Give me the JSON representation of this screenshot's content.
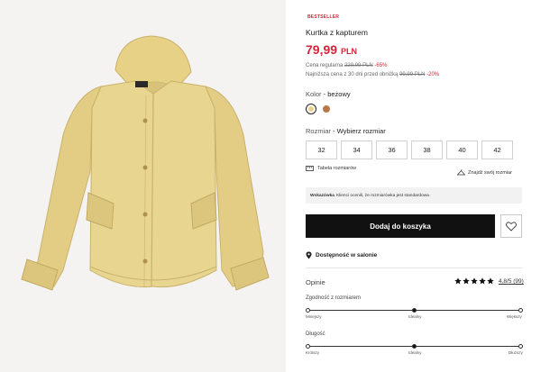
{
  "product": {
    "badge": "BESTSELLER",
    "title": "Kurtka z kapturem",
    "price": "79,99",
    "currency": "PLN",
    "regular_label": "Cena regularna",
    "regular_price": "229,99 PLN",
    "regular_discount": "-65%",
    "lowest_label": "Najniższa cena z 30 dni przed obniżką",
    "lowest_price": "99,99 PLN",
    "lowest_discount": "-20%"
  },
  "color": {
    "label": "Kolor",
    "value": "- beżowy",
    "swatches": [
      {
        "name": "beżowy",
        "hex": "#e8d28a",
        "selected": true
      },
      {
        "name": "brązowy",
        "hex": "#b8794a",
        "selected": false
      }
    ]
  },
  "size": {
    "label": "Rozmiar",
    "value": "- Wybierz rozmiar",
    "options": [
      "32",
      "34",
      "36",
      "38",
      "40",
      "42"
    ],
    "table_link": "Tabela rozmiarów",
    "find_link": "Znajdź swój rozmiar"
  },
  "hint": {
    "bold": "Wskazówka",
    "text": "Klienci ocenili, że rozmiarówka jest standardowa."
  },
  "actions": {
    "add_to_cart": "Dodaj do koszyka",
    "wishlist_icon": "heart-icon"
  },
  "availability": {
    "label": "Dostępność w salonie",
    "icon": "map-pin-icon"
  },
  "reviews": {
    "label": "Opinie",
    "stars": 5,
    "rating": "4,8/5 (99)"
  },
  "fit": {
    "title": "Zgodność z rozmiarem",
    "left": "Mniejszy",
    "middle": "Idealny",
    "right": "Większy",
    "level": 0.5
  },
  "length": {
    "title": "Długość",
    "left": "Krótszy",
    "middle": "Idealny",
    "right": "Dłuższy",
    "level": 0.5
  },
  "colors": {
    "accent_red": "#d6243a",
    "button_black": "#111111",
    "jacket": "#e8d590"
  }
}
